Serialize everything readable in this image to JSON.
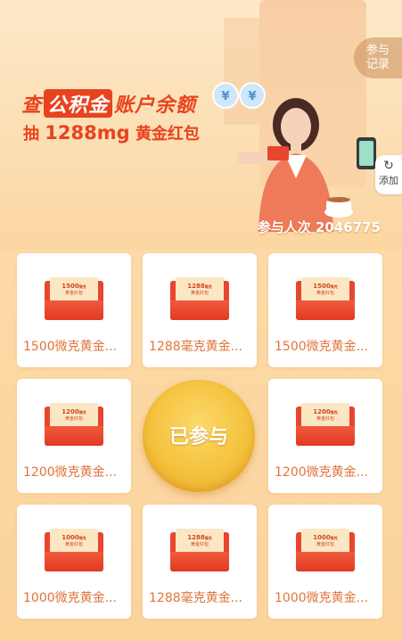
{
  "hero": {
    "headline_pre": "查",
    "headline_highlight": "公积金",
    "headline_post": "账户余额",
    "subline_pre": "抽",
    "subline_amount": "1288mg",
    "subline_post": "黄金红包",
    "participants_label": "参与人次",
    "participants_count": "2046775",
    "record_line1": "参与",
    "record_line2": "记录",
    "add_label": "添加",
    "add_icon": "refresh-icon"
  },
  "center_button": {
    "label": "已参与"
  },
  "cards": [
    {
      "amount": "1500",
      "unit": "微克",
      "env_label": "黄金红包",
      "label": "1500微克黄金..."
    },
    {
      "amount": "1288",
      "unit": "毫克",
      "env_label": "黄金红包",
      "label": "1288毫克黄金..."
    },
    {
      "amount": "1500",
      "unit": "微克",
      "env_label": "黄金红包",
      "label": "1500微克黄金..."
    },
    {
      "amount": "1200",
      "unit": "微克",
      "env_label": "黄金红包",
      "label": "1200微克黄金..."
    },
    {
      "amount": "1200",
      "unit": "微克",
      "env_label": "黄金红包",
      "label": "1200微克黄金..."
    },
    {
      "amount": "1000",
      "unit": "微克",
      "env_label": "黄金红包",
      "label": "1000微克黄金..."
    },
    {
      "amount": "1288",
      "unit": "毫克",
      "env_label": "黄金红包",
      "label": "1288毫克黄金..."
    },
    {
      "amount": "1000",
      "unit": "微克",
      "env_label": "黄金红包",
      "label": "1000微克黄金..."
    }
  ],
  "colors": {
    "accent": "#e8431f",
    "gold": "#f4c23e",
    "card_text": "#e0743a"
  }
}
